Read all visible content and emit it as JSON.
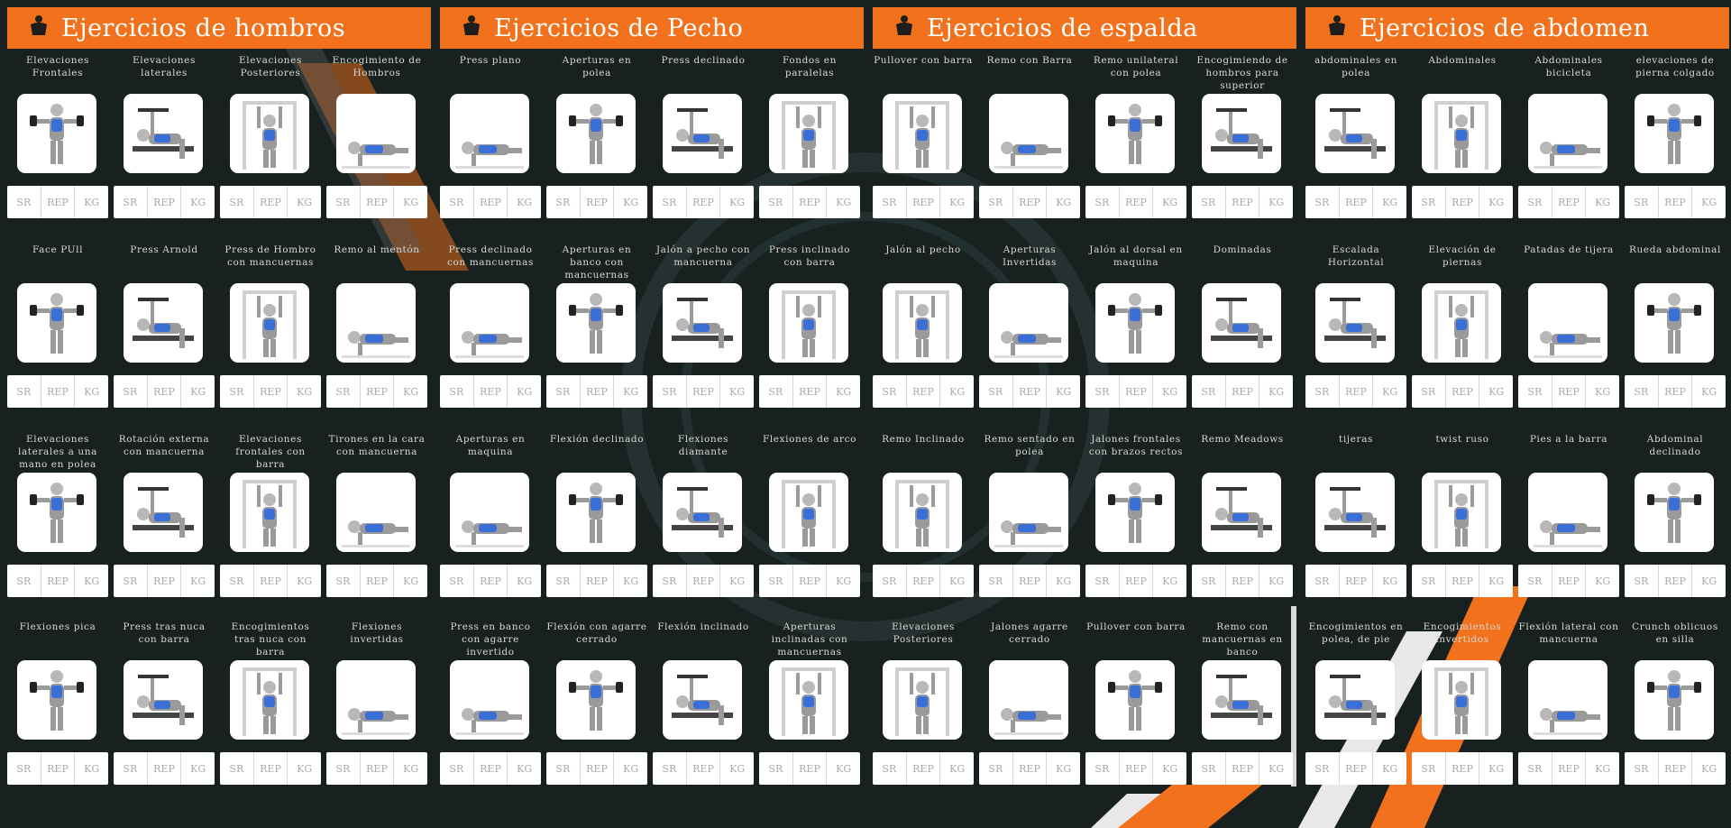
{
  "accent_color": "#f2711c",
  "background_color": "#182120",
  "input_labels": [
    "SR",
    "REP",
    "KG"
  ],
  "columns": [
    {
      "title": "Ejercicios de hombros",
      "icon": "shoulder-muscle-icon",
      "exercises": [
        "Elevaciones Frontales",
        "Elevaciones laterales",
        "Elevaciones Posteriores",
        "Encogimiento de Hombros",
        "Face PUll",
        "Press Arnold",
        "Press de Hombro con mancuernas",
        "Remo al mentón",
        "Elevaciones laterales a una mano en polea",
        "Rotación externa con mancuerna",
        "Elevaciones frontales con barra",
        "Tirones en la cara con mancuerna",
        "Flexiones pica",
        "Press tras nuca con barra",
        "Encogimientos tras nuca con barra",
        "Flexiones invertidas"
      ]
    },
    {
      "title": "Ejercicios de Pecho",
      "icon": "chest-muscle-icon",
      "exercises": [
        "Press plano",
        "Aperturas en polea",
        "Press declinado",
        "Fondos en paralelas",
        "Press declinado con mancuernas",
        "Aperturas en banco con mancuernas",
        "Jalón a pecho con mancuerna",
        "Press inclinado con barra",
        "Aperturas en maquina",
        "Flexión declinado",
        "Flexiones diamante",
        "Flexiones de arco",
        "Press en banco con agarre invertido",
        "Flexión con agarre cerrado",
        "Flexión inclinado",
        "Aperturas inclinadas con mancuernas"
      ]
    },
    {
      "title": "Ejercicios de espalda",
      "icon": "back-muscle-icon",
      "exercises": [
        "Pullover con barra",
        "Remo con Barra",
        "Remo unilateral con polea",
        "Encogimiendo de hombros para superior",
        "Jalón al pecho",
        "Aperturas Invertidas",
        "Jalón al dorsal en maquina",
        "Dominadas",
        "Remo Inclinado",
        "Remo sentado en polea",
        "Jalones frontales con brazos rectos",
        "Remo Meadows",
        "Elevaciones Posteriores",
        "Jalones agarre cerrado",
        "Pullover con barra",
        "Remo con mancuernas en banco"
      ]
    },
    {
      "title": "Ejercicios de abdomen",
      "icon": "abs-muscle-icon",
      "exercises": [
        "abdominales en polea",
        "Abdominales",
        "Abdominales bicicleta",
        "elevaciones de pierna colgado",
        "Escalada Horizontal",
        "Elevación de piernas",
        "Patadas de tijera",
        "Rueda abdominal",
        "tijeras",
        "twist ruso",
        "Pies a la barra",
        "Abdominal declinado",
        "Encogimientos en polea, de pie",
        "Encogimientos invertidos",
        "Flexión lateral con mancuerna",
        "Crunch oblicuos en silla"
      ]
    }
  ]
}
